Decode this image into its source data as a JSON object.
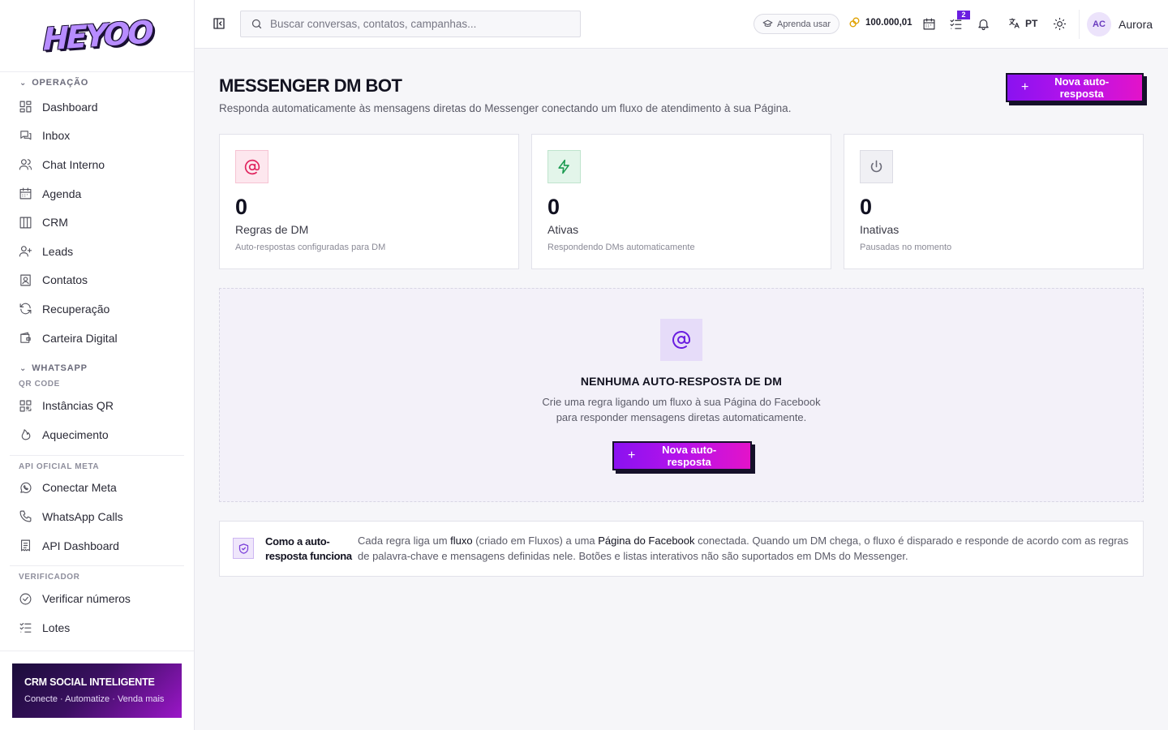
{
  "brand": {
    "logo_text": "HEYOO"
  },
  "sidebar": {
    "sections": {
      "operacao": "OPERAÇÃO",
      "whatsapp": "WHATSAPP",
      "qr_code": "QR CODE",
      "api_oficial": "API OFICIAL META",
      "verificador": "VERIFICADOR"
    },
    "items": {
      "dashboard": "Dashboard",
      "inbox": "Inbox",
      "chat_interno": "Chat Interno",
      "agenda": "Agenda",
      "crm": "CRM",
      "leads": "Leads",
      "contatos": "Contatos",
      "recuperacao": "Recuperação",
      "carteira": "Carteira Digital",
      "instancias_qr": "Instâncias QR",
      "aquecimento": "Aquecimento",
      "conectar_meta": "Conectar Meta",
      "whatsapp_calls": "WhatsApp Calls",
      "api_dashboard": "API Dashboard",
      "verificar_numeros": "Verificar números",
      "lotes": "Lotes"
    },
    "promo": {
      "title": "CRM SOCIAL INTELIGENTE",
      "subtitle": "Conecte · Automatize · Venda mais"
    }
  },
  "topbar": {
    "search_placeholder": "Buscar conversas, contatos, campanhas...",
    "learn_label": "Aprenda usar",
    "credits": "100.000,01",
    "tasks_badge": "2",
    "language": "PT",
    "user_initials": "AC",
    "user_name": "Aurora"
  },
  "page": {
    "title": "MESSENGER DM BOT",
    "subtitle": "Responda automaticamente às mensagens diretas do Messenger conectando um fluxo de atendimento à sua Página.",
    "new_button": "Nova auto-resposta"
  },
  "stats": [
    {
      "value": "0",
      "label": "Regras de DM",
      "desc": "Auto-respostas configuradas para DM",
      "icon": "at-icon",
      "color": "#e0245e"
    },
    {
      "value": "0",
      "label": "Ativas",
      "desc": "Respondendo DMs automaticamente",
      "icon": "bolt-icon",
      "color": "#1a9a50"
    },
    {
      "value": "0",
      "label": "Inativas",
      "desc": "Pausadas no momento",
      "icon": "power-icon",
      "color": "#6b6b78"
    }
  ],
  "empty_state": {
    "title": "NENHUMA AUTO-RESPOSTA DE DM",
    "description": "Crie uma regra ligando um fluxo à sua Página do Facebook para responder mensagens diretas automaticamente.",
    "button": "Nova auto-resposta"
  },
  "info": {
    "heading": "Como a auto-resposta funciona",
    "text_1": "Cada regra liga um ",
    "strong_1": "fluxo",
    "text_2": " (criado em Fluxos) a uma ",
    "strong_2": "Página do Facebook",
    "text_3": " conectada. Quando um DM chega, o fluxo é disparado e responde de acordo com as regras de palavra-chave e mensagens definidas nele. Botões e listas interativos não são suportados em DMs do Messenger."
  },
  "colors": {
    "accent": "#8a12f0",
    "accent_2": "#e313c9",
    "dark": "#15112a"
  }
}
